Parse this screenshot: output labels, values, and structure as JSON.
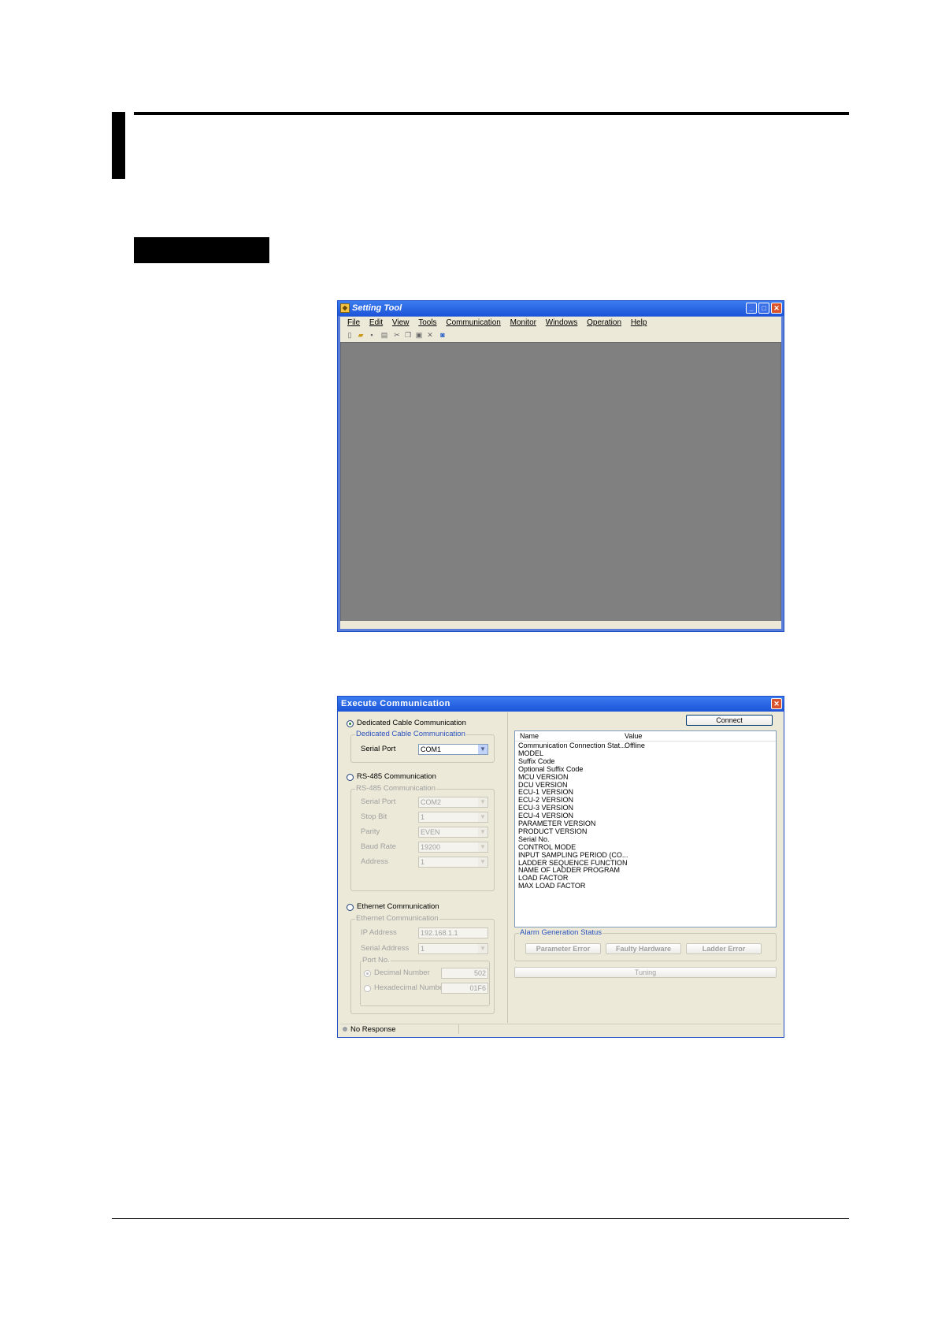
{
  "main_window": {
    "title": "Setting Tool",
    "menu": [
      "File",
      "Edit",
      "View",
      "Tools",
      "Communication",
      "Monitor",
      "Windows",
      "Operation",
      "Help"
    ]
  },
  "dialog": {
    "title": "Execute Communication",
    "dedicated": {
      "radio_label": "Dedicated Cable Communication",
      "group_label": "Dedicated Cable Communication",
      "serial_port_label": "Serial Port",
      "serial_port_value": "COM1"
    },
    "rs485": {
      "radio_label": "RS-485 Communication",
      "group_label": "RS-485 Communication",
      "fields": [
        {
          "label": "Serial Port",
          "value": "COM2"
        },
        {
          "label": "Stop Bit",
          "value": "1"
        },
        {
          "label": "Parity",
          "value": "EVEN"
        },
        {
          "label": "Baud Rate",
          "value": "19200"
        },
        {
          "label": "Address",
          "value": "1"
        }
      ]
    },
    "ethernet": {
      "radio_label": "Ethernet Communication",
      "group_label": "Ethernet Communication",
      "ip_label": "IP Address",
      "ip_value": "192.168.1.1",
      "serial_address_label": "Serial Address",
      "serial_address_value": "1",
      "port_group_label": "Port No.",
      "decimal_label": "Decimal Number",
      "decimal_value": "502",
      "hex_label": "Hexadecimal Number",
      "hex_value": "01F6"
    },
    "connect_label": "Connect",
    "list": {
      "col_name": "Name",
      "col_value": "Value",
      "rows": [
        {
          "name": "Communication Connection Stat...",
          "value": "Offline"
        },
        {
          "name": "MODEL",
          "value": ""
        },
        {
          "name": "Suffix Code",
          "value": ""
        },
        {
          "name": "Optional Suffix Code",
          "value": ""
        },
        {
          "name": "MCU VERSION",
          "value": ""
        },
        {
          "name": "DCU VERSION",
          "value": ""
        },
        {
          "name": "ECU-1 VERSION",
          "value": ""
        },
        {
          "name": "ECU-2 VERSION",
          "value": ""
        },
        {
          "name": "ECU-3 VERSION",
          "value": ""
        },
        {
          "name": "ECU-4 VERSION",
          "value": ""
        },
        {
          "name": "PARAMETER VERSION",
          "value": ""
        },
        {
          "name": "PRODUCT VERSION",
          "value": ""
        },
        {
          "name": "Serial No.",
          "value": ""
        },
        {
          "name": "CONTROL MODE",
          "value": ""
        },
        {
          "name": "INPUT SAMPLING PERIOD (CO...",
          "value": ""
        },
        {
          "name": "LADDER SEQUENCE FUNCTION",
          "value": ""
        },
        {
          "name": "NAME OF LADDER PROGRAM",
          "value": ""
        },
        {
          "name": "LOAD FACTOR",
          "value": ""
        },
        {
          "name": "MAX LOAD FACTOR",
          "value": ""
        }
      ]
    },
    "alarm": {
      "label": "Alarm Generation Status",
      "buttons": [
        "Parameter Error",
        "Faulty Hardware",
        "Ladder Error"
      ]
    },
    "tuning_label": "Tuning",
    "status_text": "No Response"
  }
}
